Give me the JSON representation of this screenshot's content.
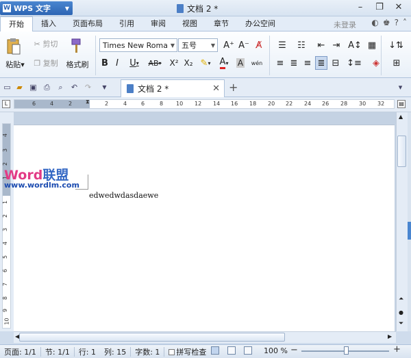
{
  "app": {
    "title": "WPS 文字",
    "doc_title": "文档 2 *"
  },
  "window": {
    "minimize": "–",
    "restore": "❐",
    "close": "✕"
  },
  "menu": [
    "开始",
    "插入",
    "页面布局",
    "引用",
    "审阅",
    "视图",
    "章节",
    "办公空间"
  ],
  "login": "未登录",
  "ribbon": {
    "paste": "粘贴",
    "cut": "剪切",
    "copy": "复制",
    "format_painter": "格式刷",
    "font_name": "Times New Roma",
    "font_size": "五号",
    "bold": "B",
    "italic": "I",
    "underline": "U",
    "strike": "AB",
    "superscript": "X²",
    "subscript": "X₂",
    "font_color": "A",
    "char_shade": "A",
    "phonetic": "wén",
    "grow": "A⁺",
    "shrink": "A⁻"
  },
  "tabs": {
    "doc_tab": "文档 2 *",
    "close": "✕",
    "new": "+"
  },
  "ruler": {
    "h_ticks": [
      "6",
      "4",
      "2",
      "2",
      "4",
      "6",
      "8",
      "10",
      "12",
      "14",
      "16",
      "18",
      "20",
      "22",
      "24",
      "26",
      "28",
      "30",
      "32"
    ],
    "v_ticks": [
      "4",
      "3",
      "2",
      "1",
      "1",
      "2",
      "3",
      "4",
      "5",
      "6",
      "7",
      "8",
      "9",
      "10"
    ]
  },
  "document": {
    "watermark_title_a": "Word",
    "watermark_title_b": "联盟",
    "watermark_url": "www.wordlm.com",
    "body_text": "edwedwdasdaewe"
  },
  "status": {
    "page": "页面: 1/1",
    "section": "节: 1/1",
    "row": "行: 1",
    "col": "列: 15",
    "words": "字数: 1",
    "spell": "拼写检查",
    "zoom": "100 %",
    "zoom_minus": "−",
    "zoom_plus": "+",
    "zoom_percent": 100
  },
  "colors": {
    "accent": "#2d65b3",
    "watermark_pink": "#e23b86",
    "watermark_blue": "#1b4bb0"
  }
}
